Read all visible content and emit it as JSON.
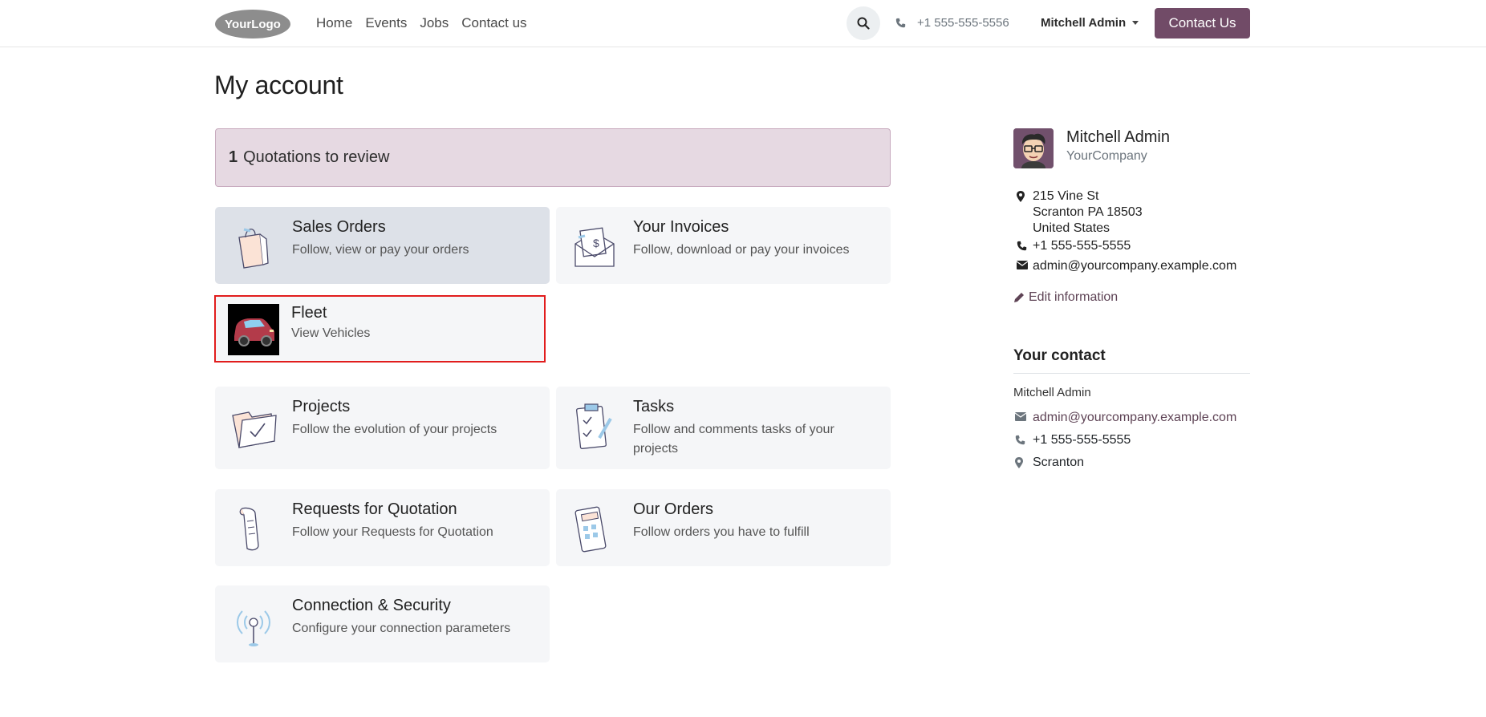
{
  "header": {
    "logo_text": "YourLogo",
    "nav": [
      "Home",
      "Events",
      "Jobs",
      "Contact us"
    ],
    "phone": "+1 555-555-5556",
    "user": "Mitchell Admin",
    "cta": "Contact Us"
  },
  "main": {
    "title": "My account",
    "alert": {
      "count": "1",
      "text": "Quotations to review"
    },
    "cards": [
      {
        "title": "Sales Orders",
        "desc": "Follow, view or pay your orders",
        "icon": "shopping-bag-icon"
      },
      {
        "title": "Your Invoices",
        "desc": "Follow, download or pay your invoices",
        "icon": "invoice-envelope-icon"
      },
      {
        "title": "Fleet",
        "desc": "View Vehicles",
        "icon": "car-icon"
      },
      {
        "title": "Projects",
        "desc": "Follow the evolution of your projects",
        "icon": "folder-check-icon"
      },
      {
        "title": "Tasks",
        "desc": "Follow and comments tasks of your projects",
        "icon": "clipboard-check-icon"
      },
      {
        "title": "Requests for Quotation",
        "desc": "Follow your Requests for Quotation",
        "icon": "scroll-icon"
      },
      {
        "title": "Our Orders",
        "desc": "Follow orders you have to fulfill",
        "icon": "calculator-icon"
      },
      {
        "title": "Connection & Security",
        "desc": "Configure your connection parameters",
        "icon": "antenna-icon"
      }
    ]
  },
  "sidebar": {
    "name": "Mitchell Admin",
    "company": "YourCompany",
    "address": [
      "215 Vine St",
      "Scranton PA 18503",
      "United States"
    ],
    "phone": "+1 555-555-5555",
    "email": "admin@yourcompany.example.com",
    "edit_label": "Edit information",
    "your_contact": {
      "heading": "Your contact",
      "name": "Mitchell Admin",
      "email": "admin@yourcompany.example.com",
      "phone": "+1 555-555-5555",
      "city": "Scranton"
    }
  },
  "colors": {
    "brand": "#714b67",
    "alert_bg": "#e6d9e2",
    "highlight_border": "#e11d1d"
  }
}
